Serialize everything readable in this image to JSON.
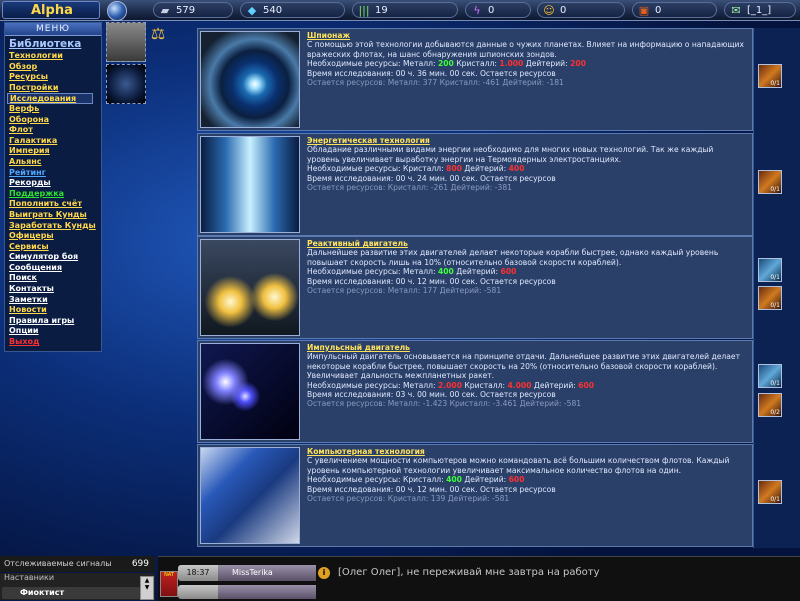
{
  "app": {
    "title": "Alpha"
  },
  "resources": [
    {
      "name": "metal",
      "icon": "ingot-icon",
      "value": "579"
    },
    {
      "name": "crystal",
      "icon": "gem-icon",
      "value": "540"
    },
    {
      "name": "deuterium",
      "icon": "bars-icon",
      "value": "19"
    },
    {
      "name": "energy",
      "icon": "lightning-icon",
      "value": "0"
    },
    {
      "name": "messages-smile",
      "icon": "smiley-icon",
      "value": "0"
    },
    {
      "name": "credits",
      "icon": "chest-icon",
      "value": "0"
    },
    {
      "name": "mail",
      "icon": "envelope-icon",
      "value": "[_1_]"
    }
  ],
  "menu": {
    "title": "МЕНЮ",
    "items": [
      {
        "label": "Библиотека",
        "color": "#a8c8ff",
        "big": true
      },
      {
        "label": "Технологии",
        "color": "#ffd84a"
      },
      {
        "label": "Обзор",
        "color": "#ffd84a"
      },
      {
        "label": "Ресурсы",
        "color": "#ffd84a"
      },
      {
        "label": "Постройки",
        "color": "#ffd84a"
      },
      {
        "label": "Исследования",
        "color": "#ffd84a",
        "selected": true
      },
      {
        "label": "Верфь",
        "color": "#ffd84a"
      },
      {
        "label": "Оборона",
        "color": "#ffd84a"
      },
      {
        "label": "Флот",
        "color": "#ffd84a"
      },
      {
        "label": "Галактика",
        "color": "#ffd84a"
      },
      {
        "label": "Империя",
        "color": "#ffd84a"
      },
      {
        "label": "Альянс",
        "color": "#ffd84a"
      },
      {
        "label": "Рейтинг",
        "color": "#50a8ff"
      },
      {
        "label": "Рекорды",
        "color": "#ffffff"
      },
      {
        "label": "Поддержка",
        "color": "#30e030"
      },
      {
        "label": "Пополнить счёт",
        "color": "#ffd84a"
      },
      {
        "label": "Выиграть Кунды",
        "color": "#ffd84a"
      },
      {
        "label": "Заработать Кунды",
        "color": "#ffd84a"
      },
      {
        "label": "Офицеры",
        "color": "#ffd84a"
      },
      {
        "label": "Сервисы",
        "color": "#ffd84a"
      },
      {
        "label": "Симулятор боя",
        "color": "#ffffff"
      },
      {
        "label": "Сообщения",
        "color": "#ffffff"
      },
      {
        "label": "Поиск",
        "color": "#ffffff"
      },
      {
        "label": "Контакты",
        "color": "#ffffff"
      },
      {
        "label": "Заметки",
        "color": "#ffffff"
      },
      {
        "label": "Новости",
        "color": "#ffd84a"
      },
      {
        "label": "Правила игры",
        "color": "#ffffff"
      },
      {
        "label": "Опции",
        "color": "#ffffff"
      },
      {
        "label": "Выход",
        "color": "#ff3030"
      }
    ]
  },
  "techs": [
    {
      "name": "Шпионаж",
      "desc": "С помощью этой технологии добываются данные о чужих планетах. Влияет на информацию о нападающих вражеских флотах, на шанс обнаружения шпионских зондов.",
      "req_prefix": "Необходимые ресурсы: Металл: ",
      "req_a": "200",
      "req_a_ok": true,
      "req_mid": " Кристалл: ",
      "req_b": "1.000",
      "req_b_ok": false,
      "req_mid2": " Дейтерий: ",
      "req_c": "200",
      "req_c_ok": false,
      "time": "Время исследования: 00 ч. 36 мин. 00 сек. Остается ресурсов",
      "remain": "Остается ресурсов: Металл: 377 Кристалл: -461 Дейтерий: -181",
      "img": "eye"
    },
    {
      "name": "Энергетическая технология",
      "desc": "Обладание различными видами энергии необходимо для многих новых технологий. Так же каждый уровень увеличивает выработку энергии на Термоядерных электростанциях.",
      "req_prefix": "Необходимые ресурсы: Кристалл: ",
      "req_a": "800",
      "req_a_ok": false,
      "req_mid": " Дейтерий: ",
      "req_b": "400",
      "req_b_ok": false,
      "req_mid2": "",
      "req_c": "",
      "req_c_ok": false,
      "time": "Время исследования: 00 ч. 24 мин. 00 сек. Остается ресурсов",
      "remain": "Остается ресурсов: Кристалл: -261 Дейтерий: -381",
      "img": "energy"
    },
    {
      "name": "Реактивный двигатель",
      "desc": "Дальнейшее развитие этих двигателей делает некоторые корабли быстрее, однако каждый уровень повышает скорость лишь на 10% (относительно базовой скорости кораблей).",
      "req_prefix": "Необходимые ресурсы: Металл: ",
      "req_a": "400",
      "req_a_ok": true,
      "req_mid": " Дейтерий: ",
      "req_b": "600",
      "req_b_ok": false,
      "req_mid2": "",
      "req_c": "",
      "req_c_ok": false,
      "time": "Время исследования: 00 ч. 12 мин. 00 сек. Остается ресурсов",
      "remain": "Остается ресурсов: Металл: 177 Дейтерий: -581",
      "img": "jet"
    },
    {
      "name": "Импульсный двигатель",
      "desc": "Импульсный двигатель основывается на принципе отдачи. Дальнейшее развитие этих двигателей делает некоторые корабли быстрее, повышает скорость на 20% (относительно базовой скорости кораблей). Увеличивает дальность межпланетных ракет.",
      "req_prefix": "Необходимые ресурсы: Металл: ",
      "req_a": "2.000",
      "req_a_ok": false,
      "req_mid": " Кристалл: ",
      "req_b": "4.000",
      "req_b_ok": false,
      "req_mid2": " Дейтерий: ",
      "req_c": "600",
      "req_c_ok": false,
      "time": "Время исследования: 03 ч. 00 мин. 00 сек. Остается ресурсов",
      "remain": "Остается ресурсов: Металл: -1.423 Кристалл: -3.461 Дейтерий: -581",
      "img": "impulse"
    },
    {
      "name": "Компьютерная технология",
      "desc": "С увеличением мощности компьютеров можно командовать всё большим количеством флотов. Каждый уровень компьютерной технологии увеличивает максимальное количество флотов на один.",
      "req_prefix": "Необходимые ресурсы: Кристалл: ",
      "req_a": "400",
      "req_a_ok": true,
      "req_mid": " Дейтерий: ",
      "req_b": "600",
      "req_b_ok": false,
      "req_mid2": "",
      "req_c": "",
      "req_c_ok": false,
      "time": "Время исследования: 00 ч. 12 мин. 00 сек. Остается ресурсов",
      "remain": "Остается ресурсов: Кристалл: 139 Дейтерий: -581",
      "img": "chip"
    }
  ],
  "right_buttons": [
    {
      "label": "0/1",
      "style": "orange"
    },
    {
      "label": "0/1",
      "style": "orange"
    },
    {
      "label": "0/1",
      "style": "blue"
    },
    {
      "label": "0/1",
      "style": "orange"
    },
    {
      "label": "0/1",
      "style": "blue"
    },
    {
      "label": "0/2",
      "style": "orange"
    },
    {
      "label": "0/1",
      "style": "orange"
    }
  ],
  "bottom": {
    "signals_label": "Отслеживаемые сигналы",
    "signals_count": "699",
    "mentors_label": "Наставники",
    "mentor_name": "Фиоктист",
    "chat_time": "18:37",
    "chat_user": "MissTerika",
    "chat_msg": "[Олег Олег], не переживай мне завтра на работу",
    "flag_text": "NAT"
  }
}
